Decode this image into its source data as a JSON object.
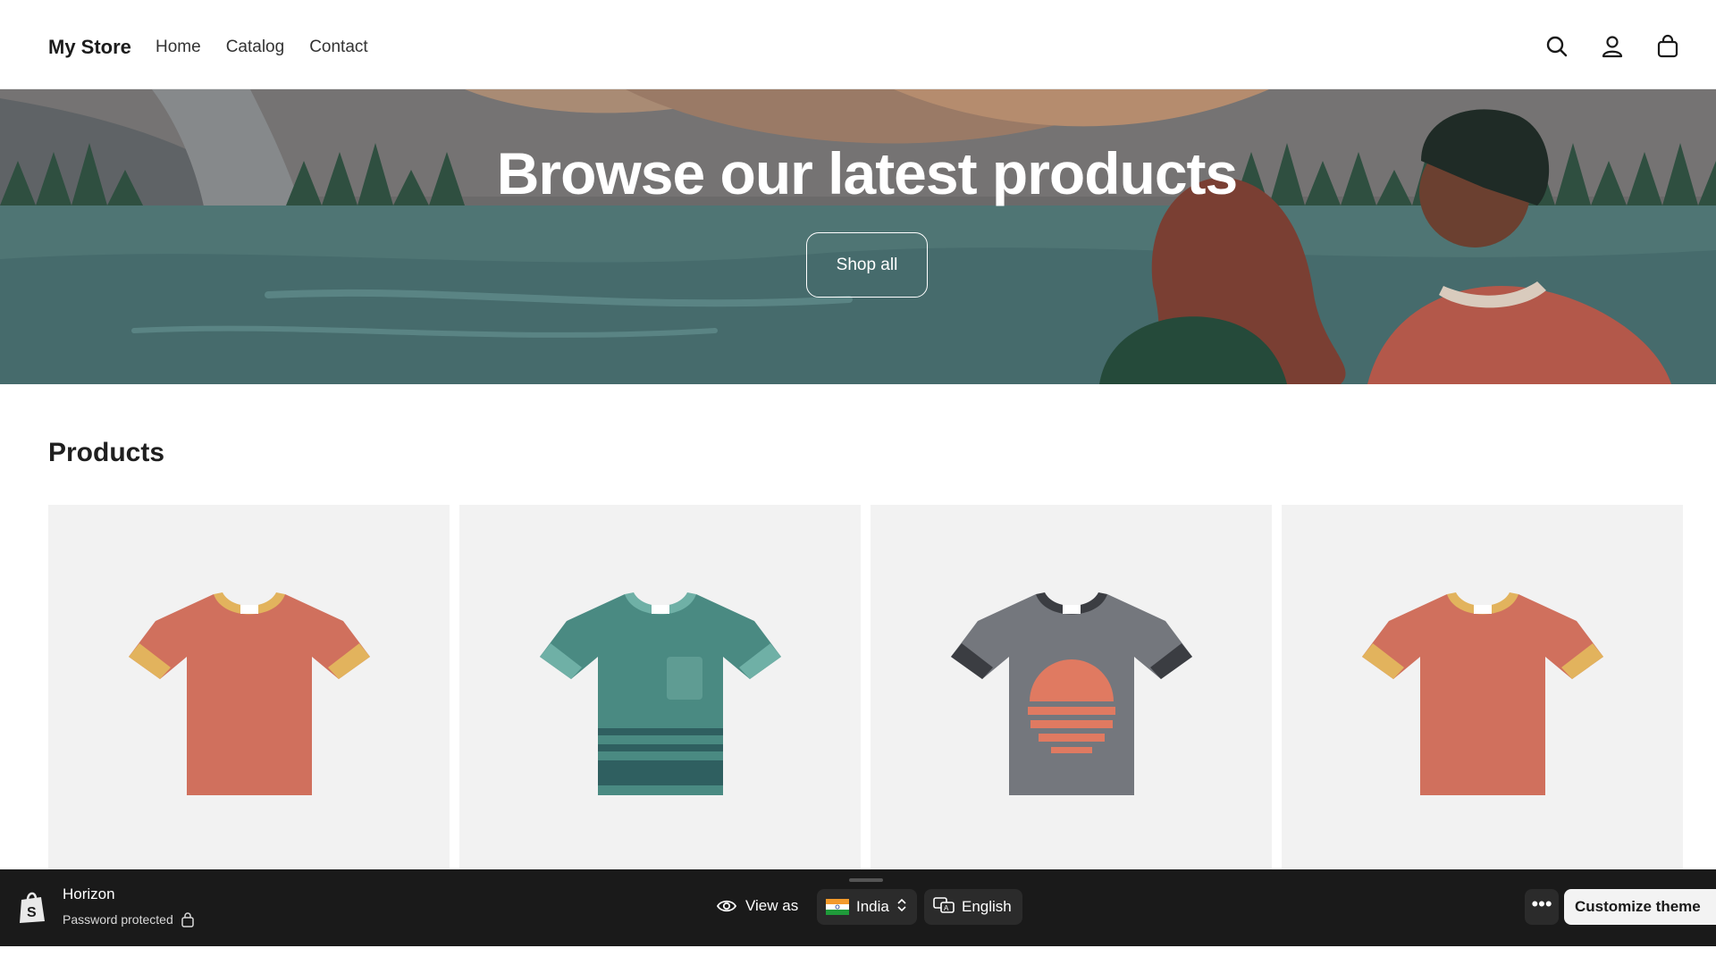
{
  "header": {
    "brand": "My Store",
    "nav": [
      "Home",
      "Catalog",
      "Contact"
    ],
    "icons": [
      "search-icon",
      "account-icon",
      "cart-icon"
    ]
  },
  "hero": {
    "title": "Browse our latest products",
    "button_label": "Shop all"
  },
  "products": {
    "heading": "Products",
    "items": [
      {
        "image": "orange-tshirt"
      },
      {
        "image": "teal-striped-tshirt"
      },
      {
        "image": "gray-sunset-tshirt"
      },
      {
        "image": "orange-tshirt"
      }
    ]
  },
  "preview_bar": {
    "theme_name": "Horizon",
    "status": "Password protected",
    "view_as_label": "View as",
    "country": "India",
    "language": "English",
    "more_label": "•••",
    "customize_label": "Customize theme"
  },
  "colors": {
    "bar_bg": "#1a1a1a",
    "card_bg": "#f2f2f2",
    "shirt_orange": "#d0705d",
    "shirt_teal": "#4a8a82",
    "shirt_gray": "#74777d"
  }
}
